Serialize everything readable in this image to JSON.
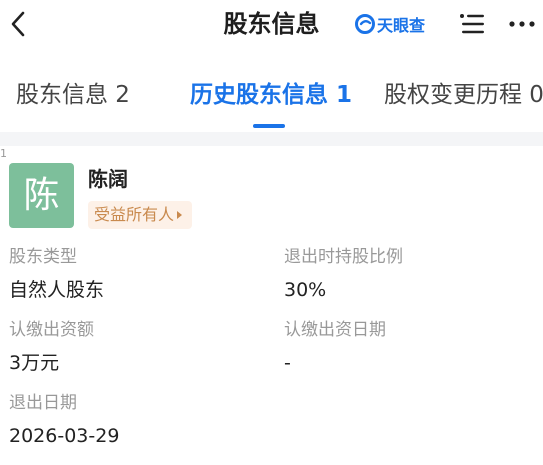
{
  "header": {
    "title": "股东信息",
    "brand_name": "天眼查",
    "back_icon": "chevron-left-icon",
    "menu_icon": "list-menu-icon",
    "more_icon": "more-dots-icon"
  },
  "tabs": [
    {
      "label": "股东信息 2",
      "active": false
    },
    {
      "label": "历史股东信息 1",
      "active": true
    },
    {
      "label": "股权变更历程 0",
      "active": false
    }
  ],
  "record": {
    "index": "1",
    "avatar_char": "陈",
    "name": "陈阔",
    "badge": "受益所有人",
    "fields": {
      "holder_type": {
        "label": "股东类型",
        "value": "自然人股东"
      },
      "exit_ratio": {
        "label": "退出时持股比例",
        "value": "30%"
      },
      "subscribed_amount": {
        "label": "认缴出资额",
        "value": "3万元"
      },
      "subscribed_date": {
        "label": "认缴出资日期",
        "value": "-"
      },
      "exit_date": {
        "label": "退出日期",
        "value": "2026-03-29"
      }
    }
  },
  "colors": {
    "accent": "#1a73e8",
    "avatar_bg": "#7dbf9b",
    "badge_bg": "#fdf1e8",
    "badge_text": "#c98a4e",
    "label_gray": "#999999",
    "band_gray": "#f4f5f7"
  }
}
